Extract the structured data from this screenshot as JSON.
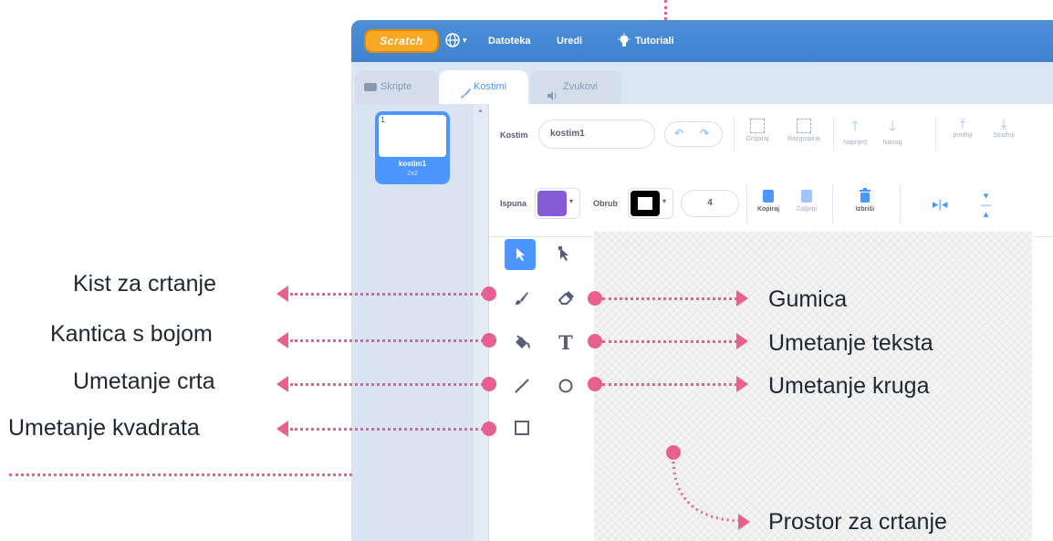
{
  "menubar": {
    "logo": "Scratch",
    "file": "Datoteka",
    "edit": "Uredi",
    "tutorials": "Tutoriali"
  },
  "tabs": [
    {
      "label": "Skripte"
    },
    {
      "label": "Kostimi"
    },
    {
      "label": "Zvukovi"
    }
  ],
  "costume_list": {
    "index": "1",
    "name": "kostim1",
    "size": "2x2"
  },
  "toolbar": {
    "costume_label": "Kostim",
    "costume_name": "kostim1",
    "group": "Grupiraj",
    "ungroup": "Razgrupiraj",
    "forward": "Naprijed",
    "backward": "Natrag",
    "front": "prednji",
    "back": "Stražnji",
    "fill_label": "Ispuna",
    "outline_label": "Obrub",
    "outline_width": "4",
    "copy": "Kopiraj",
    "paste": "Zalijepi",
    "delete": "Izbriši"
  },
  "annotations": {
    "brush": "Kist za crtanje",
    "fill": "Kantica s bojom",
    "line": "Umetanje crta",
    "rect": "Umetanje kvadrata",
    "eraser": "Gumica",
    "text": "Umetanje teksta",
    "circle": "Umetanje kruga",
    "canvas": "Prostor za crtanje"
  },
  "colors": {
    "accent": "#4c97ff",
    "fill_color": "#855cd6",
    "outline_color": "#000000",
    "annotation": "#e8608f"
  }
}
